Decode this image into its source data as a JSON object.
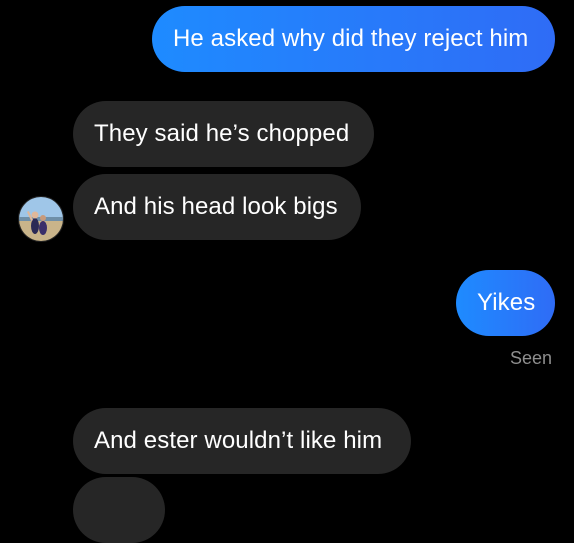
{
  "messages": [
    {
      "sender": "me",
      "text": "He asked why did they reject him"
    },
    {
      "sender": "them",
      "text": "They said he’s chopped"
    },
    {
      "sender": "them",
      "text": "And his head look bigs"
    },
    {
      "sender": "me",
      "text": "Yikes"
    },
    {
      "sender": "them",
      "text": "And ester wouldn’t like him"
    }
  ],
  "status": {
    "read_receipt": "Seen"
  },
  "colors": {
    "background": "#000000",
    "outgoing_bubble": "#1e8bff",
    "incoming_bubble": "#262626",
    "receipt_text": "#8e8e8e"
  },
  "icons": {
    "contact_avatar": "avatar"
  }
}
